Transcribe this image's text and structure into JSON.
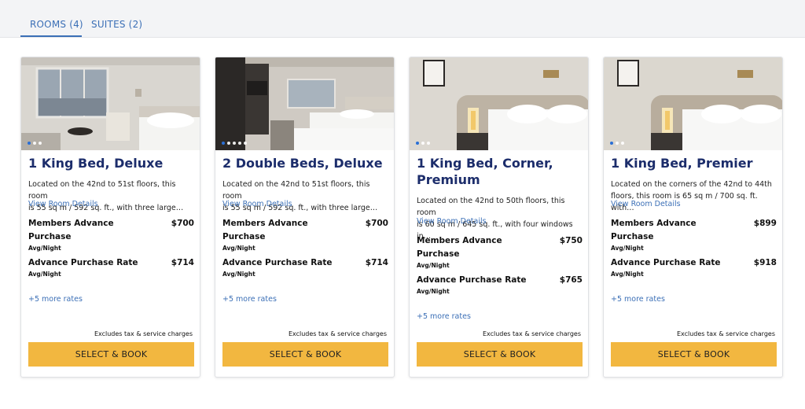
{
  "tabs": [
    {
      "label": "ROOMS (4)"
    },
    {
      "label": "SUITES (2)"
    }
  ],
  "cards": [
    {
      "title": "1 King Bed, Deluxe",
      "desc1": "Located on the 42nd to 51st floors, this room",
      "desc2": "is 55 sq m / 592 sq. ft., with three large…",
      "details_link": "View Room Details",
      "rates": [
        {
          "name": "Members Advance Purchase",
          "price": "$700",
          "unit": "Avg/Night"
        },
        {
          "name": "Advance Purchase Rate",
          "price": "$714",
          "unit": "Avg/Night"
        }
      ],
      "more_rates": "+5 more rates",
      "excludes": "Excludes tax & service charges",
      "button": "SELECT & BOOK"
    },
    {
      "title": "2 Double Beds, Deluxe",
      "desc1": "Located on the 42nd to 51st floors, this room",
      "desc2": "is 55 sq m / 592 sq. ft., with three large…",
      "details_link": "View Room Details",
      "rates": [
        {
          "name": "Members Advance Purchase",
          "price": "$700",
          "unit": "Avg/Night"
        },
        {
          "name": "Advance Purchase Rate",
          "price": "$714",
          "unit": "Avg/Night"
        }
      ],
      "more_rates": "+5 more rates",
      "excludes": "Excludes tax & service charges",
      "button": "SELECT & BOOK"
    },
    {
      "title1": "1 King Bed, Corner,",
      "title2": "Premium",
      "desc1": "Located on the 42nd to 50th floors, this room",
      "desc2": "is 60 sq m / 645 sq. ft., with four windows in…",
      "details_link": "View Room Details",
      "rates": [
        {
          "name": "Members Advance Purchase",
          "price": "$750",
          "unit": "Avg/Night"
        },
        {
          "name": "Advance Purchase Rate",
          "price": "$765",
          "unit": "Avg/Night"
        }
      ],
      "more_rates": "+5 more rates",
      "excludes": "Excludes tax & service charges",
      "button": "SELECT & BOOK"
    },
    {
      "title": "1 King Bed, Premier",
      "desc1": "Located on the corners of the 42nd to 44th",
      "desc2": "floors, this room is 65 sq m / 700 sq. ft. with…",
      "details_link": "View Room Details",
      "rates": [
        {
          "name": "Members Advance Purchase",
          "price": "$899",
          "unit": "Avg/Night"
        },
        {
          "name": "Advance Purchase Rate",
          "price": "$918",
          "unit": "Avg/Night"
        }
      ],
      "more_rates": "+5 more rates",
      "excludes": "Excludes tax & service charges",
      "button": "SELECT & BOOK"
    }
  ],
  "colors": {
    "accent": "#3b6fb6",
    "title": "#1c2d6b",
    "button": "#f2b740"
  }
}
